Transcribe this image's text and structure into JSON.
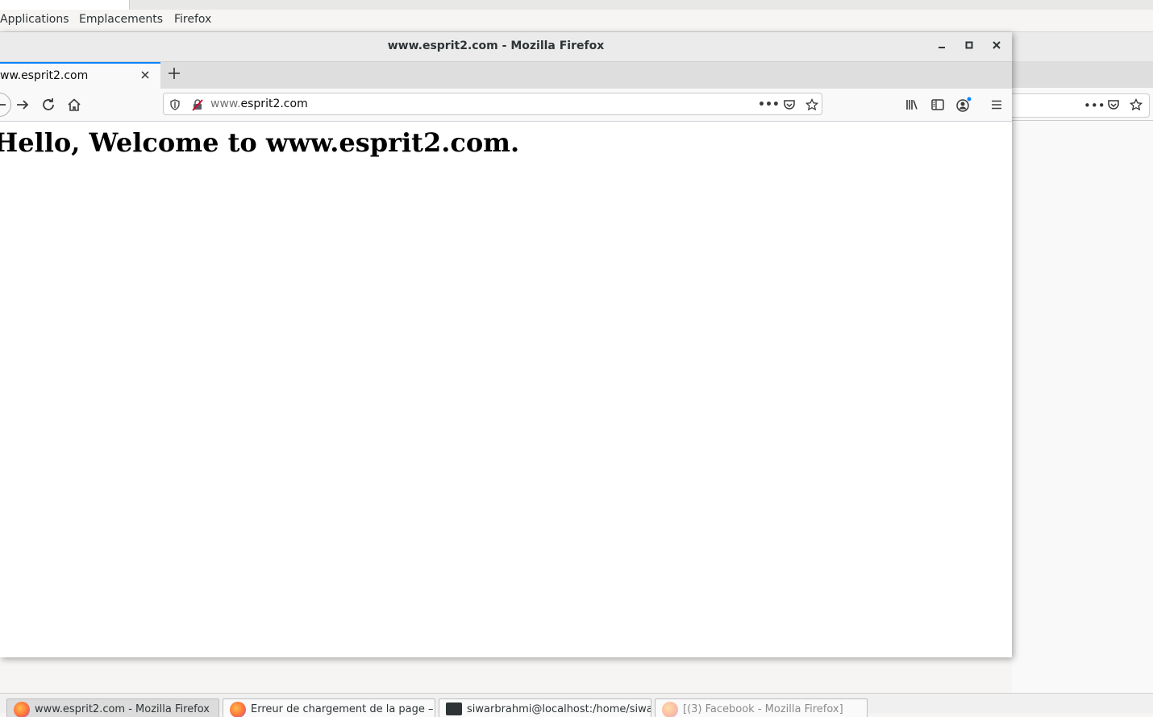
{
  "desktop_menu": {
    "applications": "Applications",
    "places": "Emplacements",
    "firefox": "Firefox"
  },
  "window": {
    "title": "www.esprit2.com - Mozilla Firefox",
    "minimize": "–",
    "maximize": "▫",
    "close": "✕"
  },
  "tab": {
    "title": "ww.esprit2.com",
    "close": "✕",
    "new_tab": "+"
  },
  "urlbar": {
    "url_prefix": "www.",
    "url_domain": "esprit2.com",
    "more": "•••"
  },
  "page": {
    "heading": "Hello, Welcome to www.esprit2.com."
  },
  "taskbar": {
    "items": [
      {
        "label": "www.esprit2.com - Mozilla Firefox",
        "active": true
      },
      {
        "label": "Erreur de chargement de la page – M",
        "active": false
      },
      {
        "label": "siwarbrahmi@localhost:/home/siwar",
        "active": false
      },
      {
        "label": "[(3) Facebook - Mozilla Firefox]",
        "active": false
      }
    ]
  },
  "icons": {
    "back": "arrow-left-icon",
    "forward": "arrow-right-icon",
    "reload": "reload-icon",
    "home": "home-icon",
    "tracking": "shield-icon",
    "insecure": "insecure-lock-icon",
    "pocket": "pocket-icon",
    "bookmark": "star-icon",
    "library": "library-icon",
    "sidebar": "sidebar-icon",
    "account": "account-icon",
    "menu": "hamburger-menu-icon"
  },
  "colors": {
    "tab_accent": "#0a84ff",
    "account_dot": "#0a84ff"
  }
}
